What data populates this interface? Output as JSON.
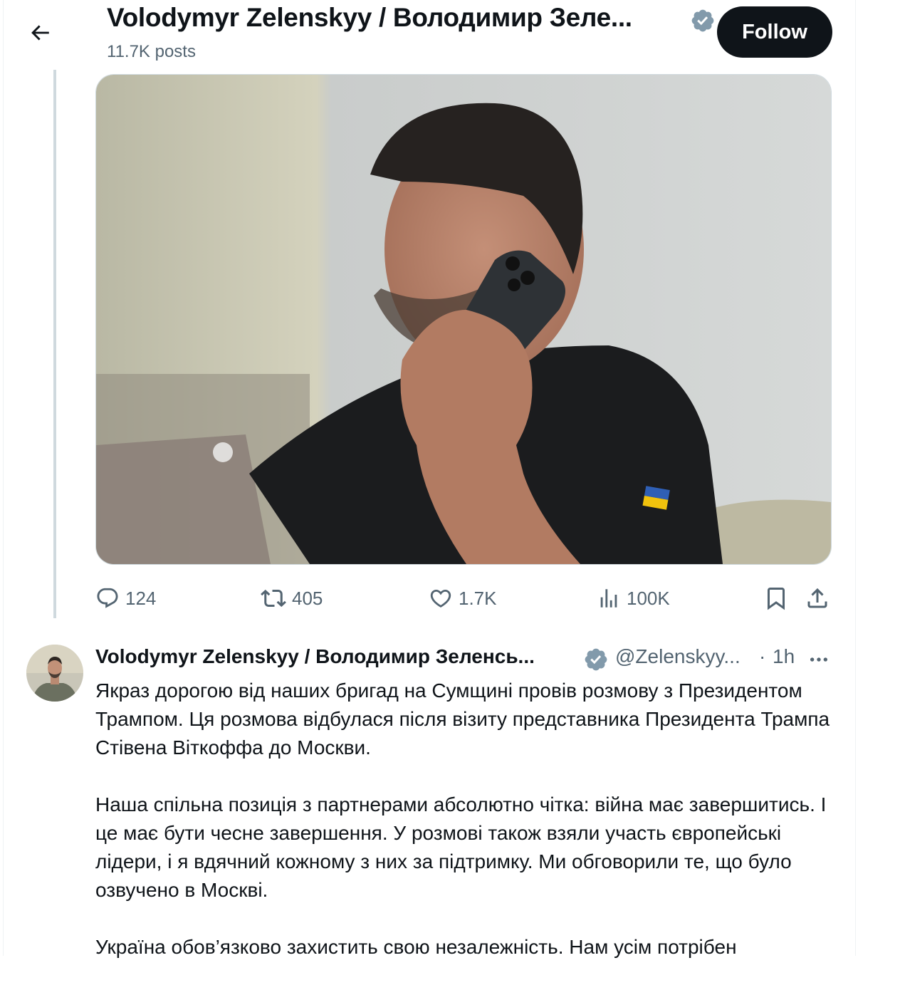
{
  "header": {
    "name": "Volodymyr Zelenskyy / Володимир Зеле...",
    "posts_count": "11.7K posts",
    "follow_label": "Follow"
  },
  "photo": {
    "alt": "Photo of man talking on phone"
  },
  "actions": {
    "replies": "124",
    "reposts": "405",
    "likes": "1.7K",
    "views": "100K"
  },
  "tweet": {
    "name": "Volodymyr Zelenskyy / Володимир Зеленсь...",
    "handle": "@Zelenskyy...",
    "separator": "·",
    "time": "1h",
    "paragraphs": [
      "Якраз дорогою від наших бригад на Сумщині провів розмову з Президентом Трампом. Ця розмова відбулася після візиту представника Президента Трампа Стівена Віткоффа до Москви.",
      "Наша спільна позиція з партнерами абсолютно чітка: війна має завершитись. І це має бути чесне завершення. У розмові також взяли участь європейські лідери, і я вдячний кожному з них за підтримку. Ми обговорили те, що було озвучено в Москві.",
      "Україна обов’язково захистить свою незалежність. Нам усім потрібен"
    ]
  },
  "colors": {
    "text_primary": "#0f1419",
    "text_secondary": "#536471",
    "verified_badge": "#829aab",
    "follow_bg": "#0f1419",
    "thread_line": "#cfd9de"
  },
  "icons": [
    "back-arrow-icon",
    "verified-badge-icon",
    "reply-icon",
    "retweet-icon",
    "like-icon",
    "views-icon",
    "bookmark-icon",
    "share-icon",
    "more-icon"
  ]
}
